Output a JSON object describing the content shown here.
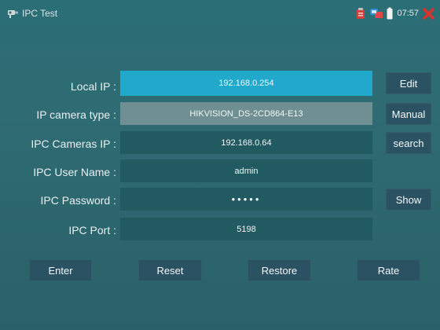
{
  "statusbar": {
    "title": "IPC Test",
    "time": "07:57"
  },
  "form": {
    "local_ip": {
      "label": "Local IP :",
      "value": "192.168.0.254"
    },
    "camera_type": {
      "label": "IP camera type :",
      "value": "HIKVISION_DS-2CD864-E13"
    },
    "cameras_ip": {
      "label": "IPC Cameras IP :",
      "value": "192.168.0.64"
    },
    "user_name": {
      "label": "IPC User Name :",
      "value": "admin"
    },
    "password": {
      "label": "IPC Password :",
      "value": "•••••"
    },
    "port": {
      "label": "IPC Port :",
      "value": "5198"
    }
  },
  "side_buttons": {
    "edit": "Edit",
    "manual": "Manual",
    "search": "search",
    "show": "Show"
  },
  "bottom_buttons": {
    "enter": "Enter",
    "reset": "Reset",
    "restore": "Restore",
    "rate": "Rate"
  },
  "colors": {
    "background": "#2f6b73",
    "field": "#225a61",
    "field_active": "#21a9cc",
    "field_select": "#6f8f93",
    "button": "#2b5262",
    "close": "#e0322b"
  },
  "icons": [
    "camera-plug-icon",
    "tool-icon",
    "network-icon",
    "battery-icon",
    "close-icon"
  ]
}
